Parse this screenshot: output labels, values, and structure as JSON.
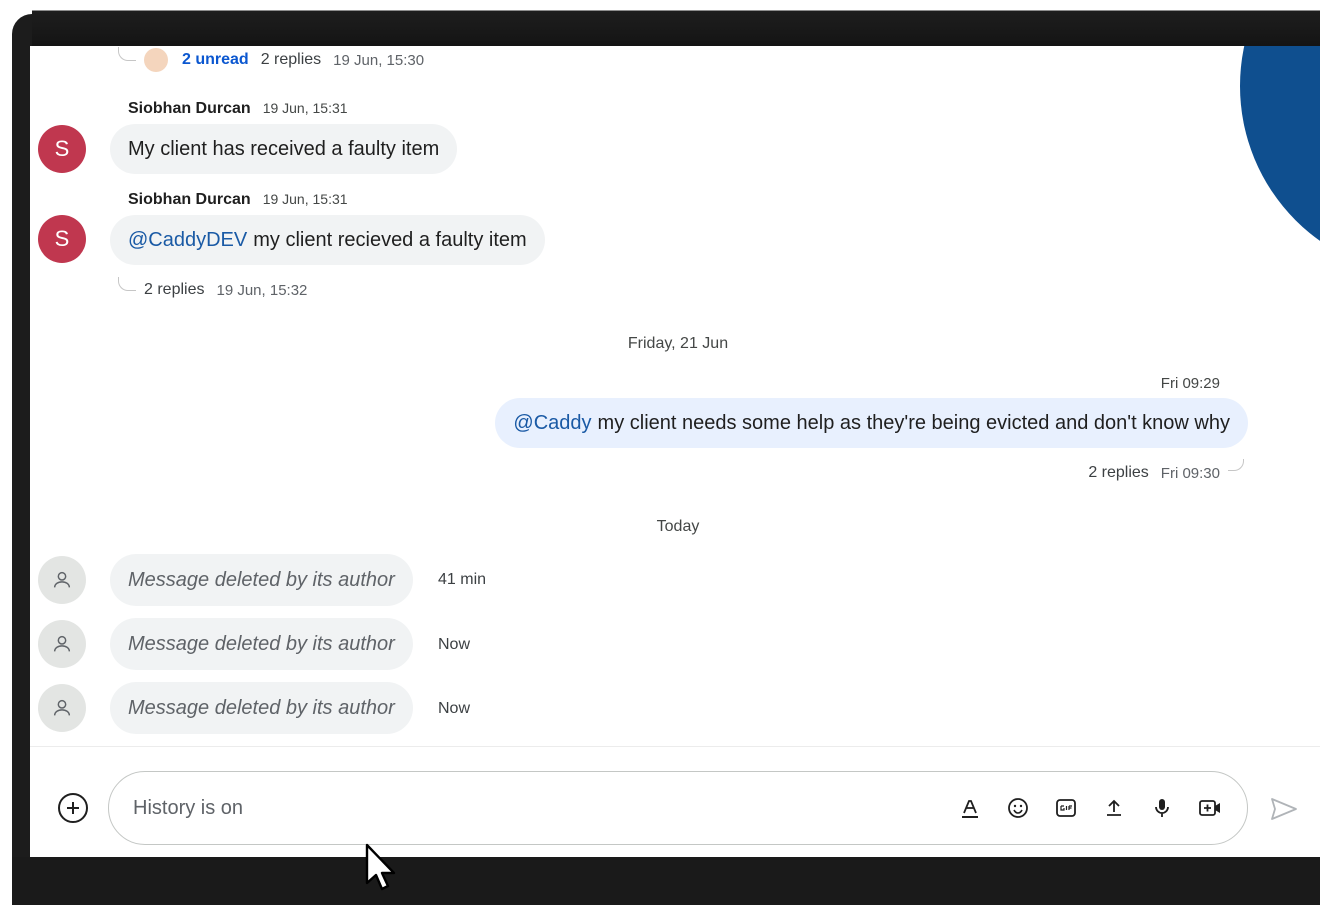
{
  "top_thread": {
    "unread": "2 unread",
    "replies": "2 replies",
    "time": "19 Jun, 15:30"
  },
  "messages": [
    {
      "avatar_letter": "S",
      "sender": "Siobhan Durcan",
      "time": "19 Jun, 15:31",
      "mention": "",
      "text": "My client has received a faulty item"
    },
    {
      "avatar_letter": "S",
      "sender": "Siobhan Durcan",
      "time": "19 Jun, 15:31",
      "mention": "@CaddyDEV",
      "text": "my client recieved a faulty item",
      "thread": {
        "replies": "2 replies",
        "time": "19 Jun, 15:32"
      }
    }
  ],
  "date_separators": [
    "Friday, 21 Jun",
    "Today"
  ],
  "own_message": {
    "time": "Fri 09:29",
    "mention": "@Caddy",
    "text": "my client needs some help as they're being evicted and don't know why",
    "thread": {
      "replies": "2 replies",
      "time": "Fri 09:30"
    }
  },
  "deleted_messages": [
    {
      "text": "Message deleted by its author",
      "time": "41 min"
    },
    {
      "text": "Message deleted by its author",
      "time": "Now"
    },
    {
      "text": "Message deleted by its author",
      "time": "Now"
    }
  ],
  "composer": {
    "placeholder": "History is on"
  },
  "toolbar_icons": [
    "format-text-icon",
    "emoji-icon",
    "gif-icon",
    "upload-icon",
    "microphone-icon",
    "video-meeting-icon",
    "send-icon",
    "add-icon"
  ],
  "colors": {
    "avatar": "#c0374f",
    "mention": "#1a5aa5",
    "own_bubble": "#e8f0fe",
    "bubble": "#f1f3f4",
    "accent_circle": "#0f4f8f"
  }
}
